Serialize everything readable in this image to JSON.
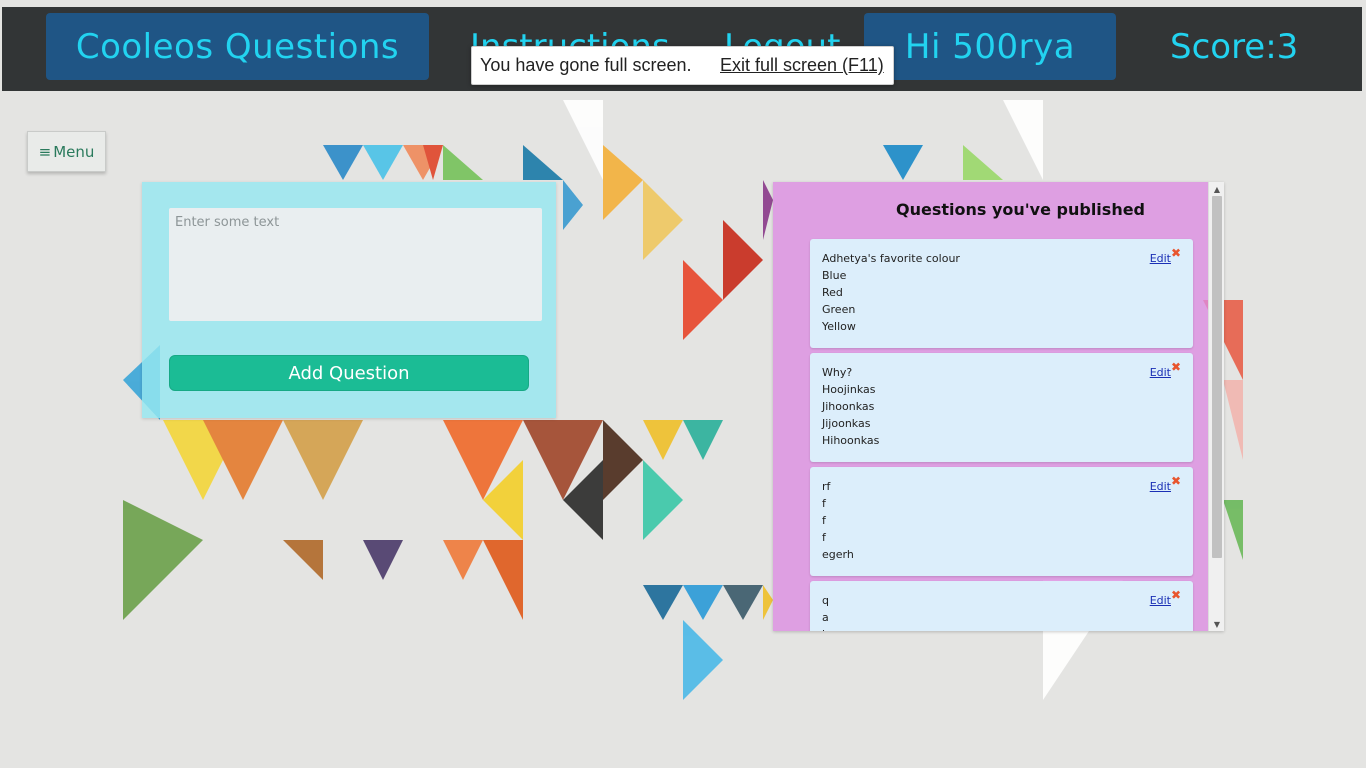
{
  "header": {
    "brand": "Cooleos Questions",
    "instructions": "Instructions",
    "logout": "Logout",
    "greeting": "Hi 500rya",
    "score": "Score:3"
  },
  "fullscreen_notice": {
    "message": "You have gone full screen.",
    "exit_label": "Exit full screen (F11)"
  },
  "menu": {
    "label": "Menu",
    "icon": "hamburger-icon"
  },
  "composer": {
    "placeholder": "Enter some text",
    "value": "",
    "add_button_label": "Add Question"
  },
  "published": {
    "title": "Questions you've published",
    "edit_label": "Edit",
    "delete_icon": "close-icon",
    "questions": [
      {
        "lines": [
          "Adhetya's favorite colour",
          "Blue",
          "Red",
          "Green",
          "Yellow"
        ]
      },
      {
        "lines": [
          "Why?",
          "Hoojinkas",
          "Jihoonkas",
          "Jijoonkas",
          "Hihoonkas"
        ]
      },
      {
        "lines": [
          "rf",
          "f",
          "f",
          "f",
          "egerh"
        ]
      },
      {
        "lines": [
          "q",
          "a",
          "b"
        ]
      }
    ]
  },
  "colors": {
    "topbar": "#323536",
    "nav_pill": "#1f5585",
    "nav_text": "#22d3f0",
    "add_button": "#1bbc95",
    "composer_panel": "#96e8f0",
    "published_panel": "#dc8ce1",
    "question_card": "#dceefb"
  }
}
